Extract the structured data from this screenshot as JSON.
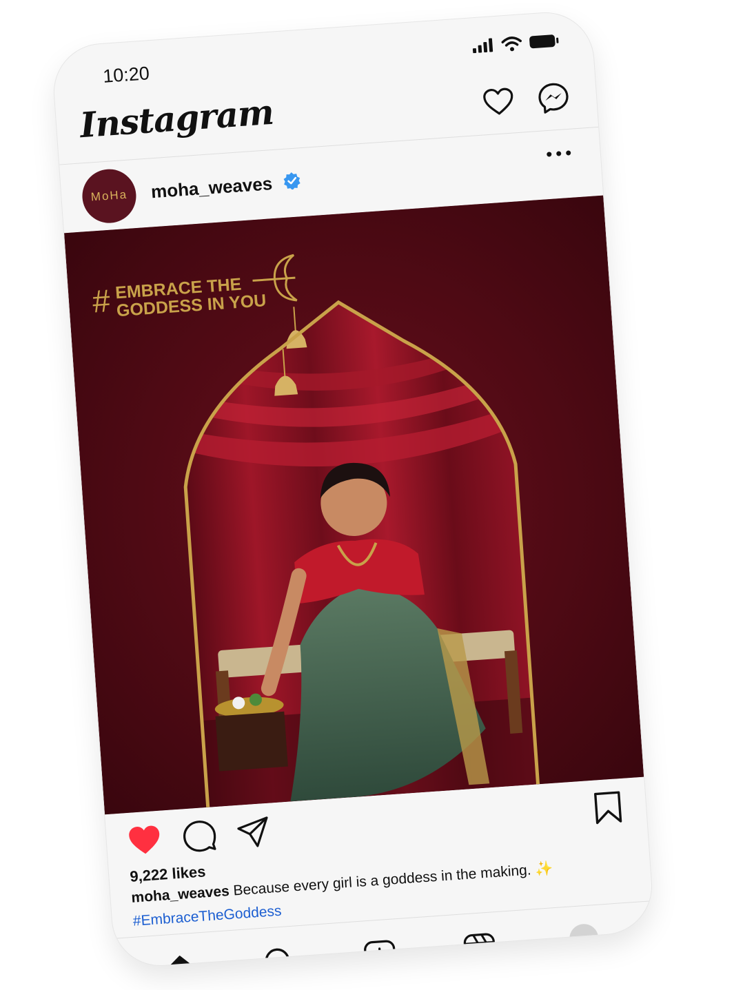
{
  "status_bar": {
    "time": "10:20"
  },
  "header": {
    "app_title": "Instagram"
  },
  "post": {
    "account": {
      "username": "moha_weaves",
      "avatar_text": "MoHa",
      "verified": true
    },
    "image": {
      "overlay_hash": "#",
      "overlay_line1": "EMBRACE THE",
      "overlay_line2": "GODDESS IN YOU"
    },
    "liked": true,
    "likes_text": "9,222 likes",
    "caption_username": "moha_weaves",
    "caption_text": "Because every girl is a goddess in the making. ✨",
    "hashtag": "#EmbraceTheGoddess"
  },
  "colors": {
    "like_red": "#ff3040",
    "verified_blue": "#3897f0",
    "hashtag_blue": "#1d5fd1",
    "brand_maroon": "#5a1320",
    "gold": "#c9a24a"
  },
  "icons": {
    "header": [
      "heart-icon",
      "messenger-icon"
    ],
    "post_actions": [
      "heart-icon",
      "comment-icon",
      "share-icon",
      "bookmark-icon"
    ],
    "tabbar": [
      "home-icon",
      "search-icon",
      "new-post-icon",
      "reels-icon",
      "profile-avatar"
    ]
  }
}
